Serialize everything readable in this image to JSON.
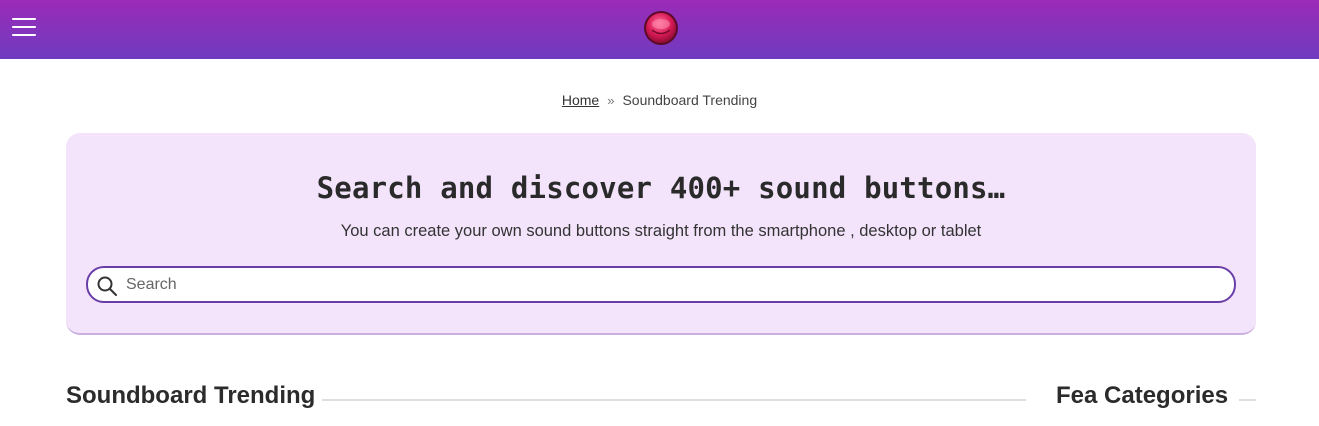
{
  "header": {
    "menu_icon": "hamburger-menu-icon",
    "logo_icon": "red-sound-button-logo",
    "brand_colors": {
      "top": "#9b2bb8",
      "bottom": "#6f3bc0"
    }
  },
  "breadcrumb": {
    "home": "Home",
    "separator": "»",
    "current": "Soundboard Trending"
  },
  "hero": {
    "title": "Search and discover 400+ sound buttons…",
    "subtitle": "You can create your own sound buttons straight from the smartphone , desktop or tablet",
    "background": "#f3e4fc",
    "search": {
      "placeholder": "Search",
      "value": "",
      "icon": "search-icon",
      "border_color": "#6a3ea8"
    }
  },
  "sections": {
    "main_title": "Soundboard Trending",
    "side_title": "Fea Categories"
  }
}
